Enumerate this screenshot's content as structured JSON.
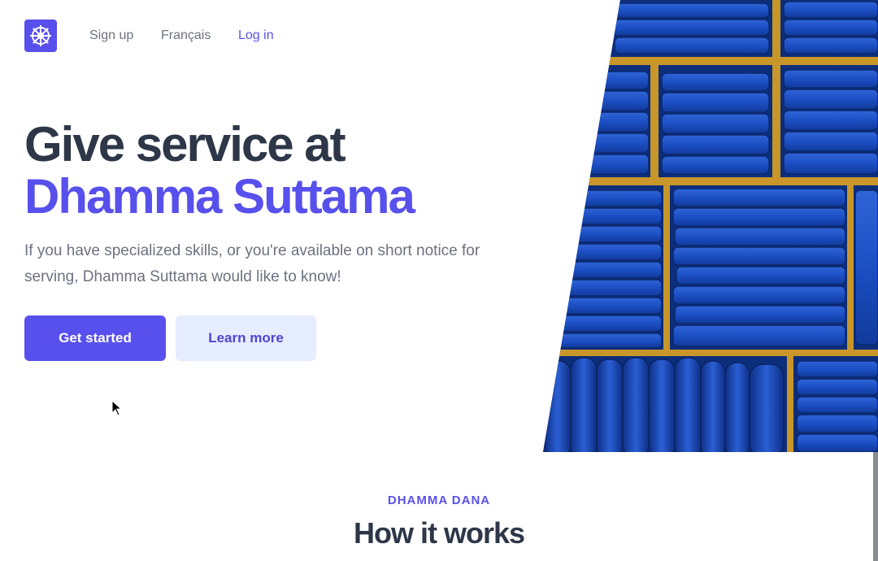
{
  "nav": {
    "logo_icon": "dharma-wheel-icon",
    "links": [
      {
        "label": "Sign up"
      },
      {
        "label": "Français"
      },
      {
        "label": "Log in"
      }
    ]
  },
  "hero": {
    "title_line1": "Give service at",
    "title_line2": "Dhamma Suttama",
    "subtitle": "If you have specialized skills, or you're available on short notice for serving, Dhamma Suttama would like to know!",
    "primary_button": "Get started",
    "secondary_button": "Learn more",
    "image_alt": "shelves-of-folded-blue-cushions"
  },
  "section": {
    "eyebrow": "DHAMMA DANA",
    "title": "How it works"
  },
  "colors": {
    "accent": "#5850ec",
    "heading": "#2d3748",
    "muted": "#6b7280",
    "secondary_btn_bg": "#e5edff"
  }
}
